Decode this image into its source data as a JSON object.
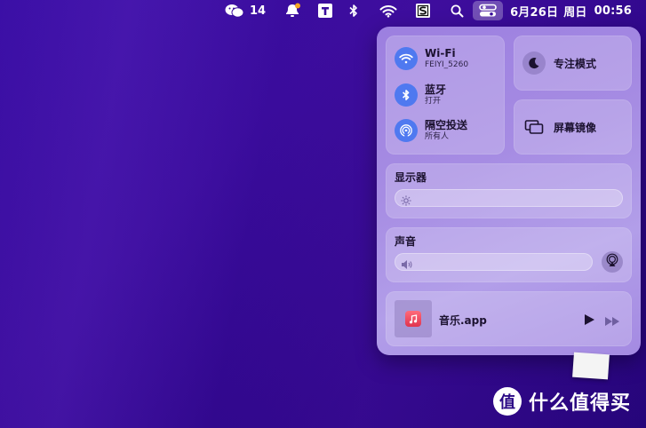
{
  "menubar": {
    "wechat_count": "14",
    "date": "6月26日",
    "weekday": "周日",
    "time": "00:56",
    "icons": [
      "wechat-icon",
      "notification-bell-icon",
      "typora-t-icon",
      "bluetooth-icon",
      "wifi-icon",
      "s-app-icon",
      "search-icon",
      "control-center-icon"
    ]
  },
  "control_center": {
    "network": {
      "wifi": {
        "title": "Wi-Fi",
        "subtitle": "FEIYI_5260"
      },
      "bluetooth": {
        "title": "蓝牙",
        "subtitle": "打开"
      },
      "airdrop": {
        "title": "隔空投送",
        "subtitle": "所有人"
      }
    },
    "focus": {
      "label": "专注模式"
    },
    "mirroring": {
      "label": "屏幕镜像"
    },
    "display": {
      "title": "显示器",
      "level": 0.0
    },
    "sound": {
      "title": "声音",
      "level": 0.0
    },
    "now_playing": {
      "app": "音乐.app"
    }
  },
  "watermark": {
    "logo_char": "值",
    "text": "什么值得买"
  },
  "colors": {
    "accent_blue": "#4f79f0",
    "desktop": "#3a0c9c",
    "panel": "#a68ce3"
  }
}
